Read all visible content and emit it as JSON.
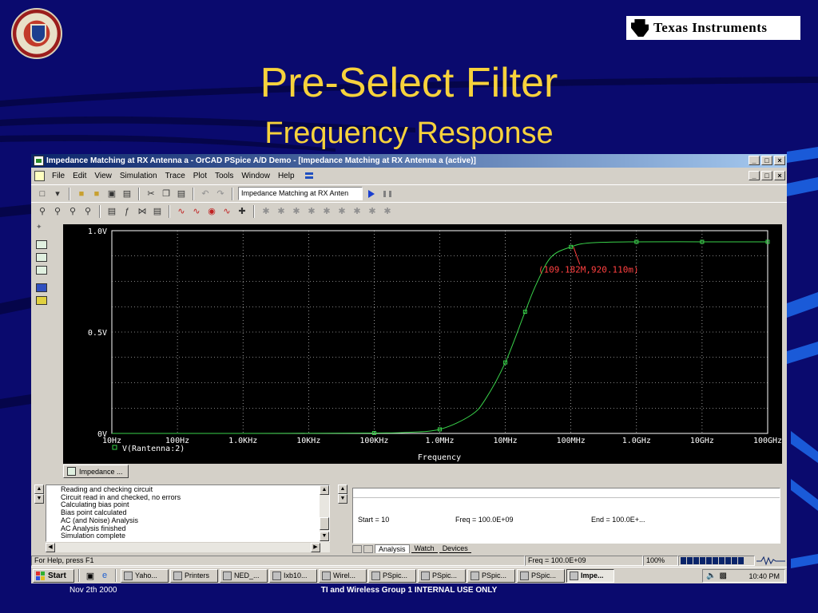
{
  "slide": {
    "title": "Pre-Select Filter",
    "subtitle": "Frequency Response",
    "logo_text": "Texas Instruments",
    "footer_date": "Nov 2th 2000",
    "footer_center": "TI and Wireless Group 1 INTERNAL USE ONLY"
  },
  "window": {
    "title": "Impedance Matching at RX Antenna a - OrCAD PSpice A/D Demo  - [Impedance Matching at RX Antenna a (active)]",
    "controls": [
      "_",
      "□",
      "×"
    ]
  },
  "menu": {
    "items": [
      "File",
      "Edit",
      "View",
      "Simulation",
      "Trace",
      "Plot",
      "Tools",
      "Window",
      "Help"
    ]
  },
  "toolbar": {
    "profile_value": "Impedance Matching at RX Anten"
  },
  "plot": {
    "cursor_label": "(109.182M,920.110m)",
    "legend_label": "V(Rantenna:2)",
    "xlabel": "Frequency",
    "xticks": [
      "10Hz",
      "100Hz",
      "1.0KHz",
      "10KHz",
      "100KHz",
      "1.0MHz",
      "10MHz",
      "100MHz",
      "1.0GHz",
      "10GHz",
      "100GHz"
    ],
    "yticks": [
      "1.0V",
      "0.5V",
      "0V"
    ],
    "trace_color": "#39d24a",
    "cursor_color": "#ff4040"
  },
  "chart_data": {
    "type": "line",
    "title": "",
    "xlabel": "Frequency",
    "ylabel": "",
    "xscale": "log",
    "xlim": [
      10,
      100000000000
    ],
    "ylim": [
      0,
      1.0
    ],
    "grid": true,
    "series": [
      {
        "name": "V(Rantenna:2)",
        "x": [
          10,
          1000,
          100000,
          300000,
          1000000,
          3000000,
          5000000,
          10000000,
          20000000,
          30000000,
          50000000,
          100000000,
          200000000,
          1000000000,
          10000000000,
          100000000000
        ],
        "y": [
          0,
          0,
          0.002,
          0.005,
          0.02,
          0.09,
          0.17,
          0.35,
          0.6,
          0.74,
          0.87,
          0.92,
          0.94,
          0.945,
          0.945,
          0.945
        ]
      }
    ],
    "annotations": [
      {
        "x": 109182000,
        "y": 0.92011,
        "text": "(109.182M,920.110m)"
      }
    ]
  },
  "doc_tab": {
    "label": "Impedance ..."
  },
  "output": {
    "lines": [
      "Reading and checking circuit",
      "Circuit read in and checked, no errors",
      "Calculating bias point",
      "Bias point calculated",
      "AC (and Noise) Analysis",
      "AC Analysis finished",
      "Simulation complete"
    ]
  },
  "watch": {
    "start": "Start =  10",
    "freq": "Freq =  100.0E+09",
    "end": "End =  100.0E+..."
  },
  "bottom_tabs": [
    "Analysis",
    "Watch",
    "Devices"
  ],
  "status": {
    "help": "For Help, press F1",
    "freq": "Freq =  100.0E+09",
    "percent": "100%"
  },
  "taskbar": {
    "start": "Start",
    "buttons": [
      "Yaho...",
      "Printers",
      "NED_...",
      "Ixb10...",
      "Wirel...",
      "PSpic...",
      "PSpic...",
      "PSpic...",
      "PSpic...",
      "Impe..."
    ],
    "clock": "10:40 PM"
  }
}
